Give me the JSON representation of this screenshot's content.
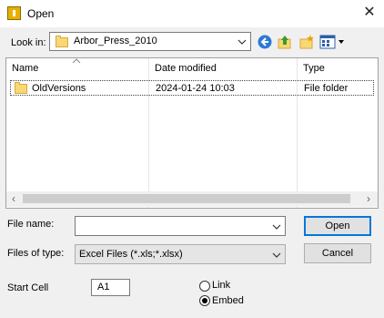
{
  "window": {
    "title": "Open",
    "close_icon": "close-icon"
  },
  "lookin": {
    "label": "Look in:",
    "value": "Arbor_Press_2010"
  },
  "toolbar": {
    "icons": [
      "back-icon",
      "up-folder-icon",
      "new-folder-icon",
      "view-menu-icon"
    ]
  },
  "filelist": {
    "columns": [
      "Name",
      "Date modified",
      "Type"
    ],
    "rows": [
      {
        "name": "OldVersions",
        "date": "2024-01-24 10:03",
        "type": "File folder"
      }
    ]
  },
  "filename": {
    "label": "File name:",
    "value": ""
  },
  "filetype": {
    "label": "Files of type:",
    "value": "Excel Files (*.xls;*.xlsx)"
  },
  "buttons": {
    "open": "Open",
    "cancel": "Cancel"
  },
  "startcell": {
    "label": "Start Cell",
    "value": "A1"
  },
  "placement": {
    "options": [
      "Link",
      "Embed"
    ],
    "selected": "Embed"
  }
}
